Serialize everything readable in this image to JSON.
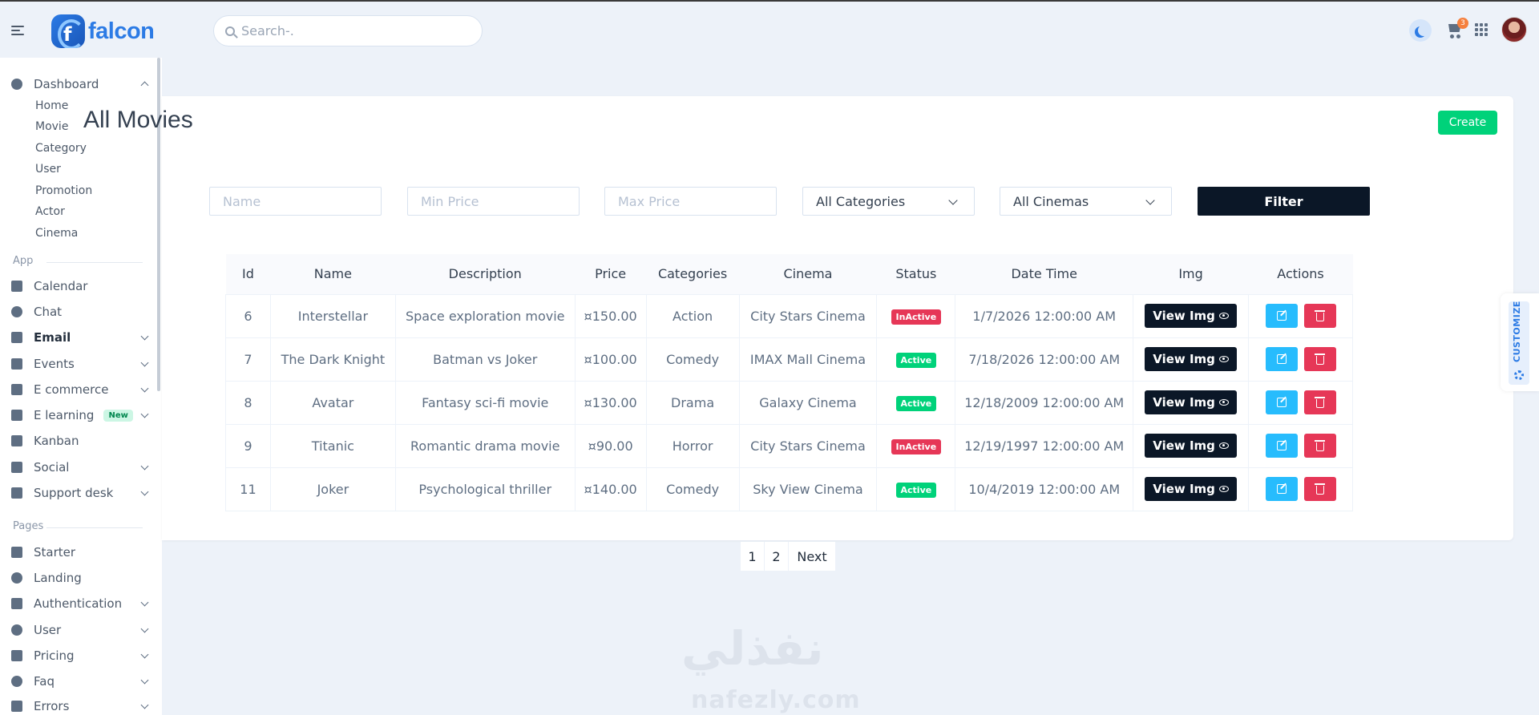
{
  "brand": {
    "name": "falcon"
  },
  "search": {
    "placeholder": "Search-."
  },
  "header": {
    "cart_count": "3"
  },
  "sidebar": {
    "dashboard": {
      "label": "Dashboard",
      "items": [
        "Home",
        "Movie",
        "Category",
        "User",
        "Promotion",
        "Actor",
        "Cinema"
      ]
    },
    "app_section": "App",
    "app_items": [
      {
        "label": "Calendar",
        "icon": "calendar-icon"
      },
      {
        "label": "Chat",
        "icon": "chat-icon"
      },
      {
        "label": "Email",
        "icon": "email-icon"
      },
      {
        "label": "Events",
        "icon": "events-icon"
      },
      {
        "label": "E commerce",
        "icon": "cart-icon"
      },
      {
        "label": "E learning",
        "icon": "graduation-cap-icon",
        "badge": "New"
      },
      {
        "label": "Kanban",
        "icon": "kanban-icon"
      },
      {
        "label": "Social",
        "icon": "share-icon"
      },
      {
        "label": "Support desk",
        "icon": "support-icon"
      }
    ],
    "pages_section": "Pages",
    "pages_items": [
      {
        "label": "Starter",
        "icon": "flag-icon"
      },
      {
        "label": "Landing",
        "icon": "globe-icon"
      },
      {
        "label": "Authentication",
        "icon": "lock-icon"
      },
      {
        "label": "User",
        "icon": "user-icon"
      },
      {
        "label": "Pricing",
        "icon": "tags-icon"
      },
      {
        "label": "Faq",
        "icon": "question-icon"
      },
      {
        "label": "Errors",
        "icon": "warning-icon"
      }
    ]
  },
  "page": {
    "title": "All Movies",
    "create_label": "Create"
  },
  "filters": {
    "name_placeholder": "Name",
    "min_price_placeholder": "Min Price",
    "max_price_placeholder": "Max Price",
    "category_selected": "All Categories",
    "cinema_selected": "All Cinemas",
    "filter_label": "Filter"
  },
  "table": {
    "headers": [
      "Id",
      "Name",
      "Description",
      "Price",
      "Categories",
      "Cinema",
      "Status",
      "Date Time",
      "Img",
      "Actions"
    ],
    "view_label": "View Img",
    "rows": [
      {
        "id": "6",
        "name": "Interstellar",
        "description": "Space exploration movie",
        "price": "¤150.00",
        "category": "Action",
        "cinema": "City Stars Cinema",
        "status": "InActive",
        "datetime": "1/7/2026 12:00:00 AM"
      },
      {
        "id": "7",
        "name": "The Dark Knight",
        "description": "Batman vs Joker",
        "price": "¤100.00",
        "category": "Comedy",
        "cinema": "IMAX Mall Cinema",
        "status": "Active",
        "datetime": "7/18/2026 12:00:00 AM"
      },
      {
        "id": "8",
        "name": "Avatar",
        "description": "Fantasy sci-fi movie",
        "price": "¤130.00",
        "category": "Drama",
        "cinema": "Galaxy Cinema",
        "status": "Active",
        "datetime": "12/18/2009 12:00:00 AM"
      },
      {
        "id": "9",
        "name": "Titanic",
        "description": "Romantic drama movie",
        "price": "¤90.00",
        "category": "Horror",
        "cinema": "City Stars Cinema",
        "status": "InActive",
        "datetime": "12/19/1997 12:00:00 AM"
      },
      {
        "id": "11",
        "name": "Joker",
        "description": "Psychological thriller",
        "price": "¤140.00",
        "category": "Comedy",
        "cinema": "Sky View Cinema",
        "status": "Active",
        "datetime": "10/4/2019 12:00:00 AM"
      }
    ]
  },
  "pagination": {
    "pages": [
      "1",
      "2"
    ],
    "next_label": "Next"
  },
  "customize": {
    "label": "CUSTOMIZE"
  },
  "watermark": {
    "arabic": "نفذلي",
    "latin": "nafezly.com"
  },
  "colors": {
    "primary": "#2c7be5",
    "success": "#00d27a",
    "danger": "#e63757",
    "info": "#27bcfd",
    "dark": "#0b1727"
  }
}
